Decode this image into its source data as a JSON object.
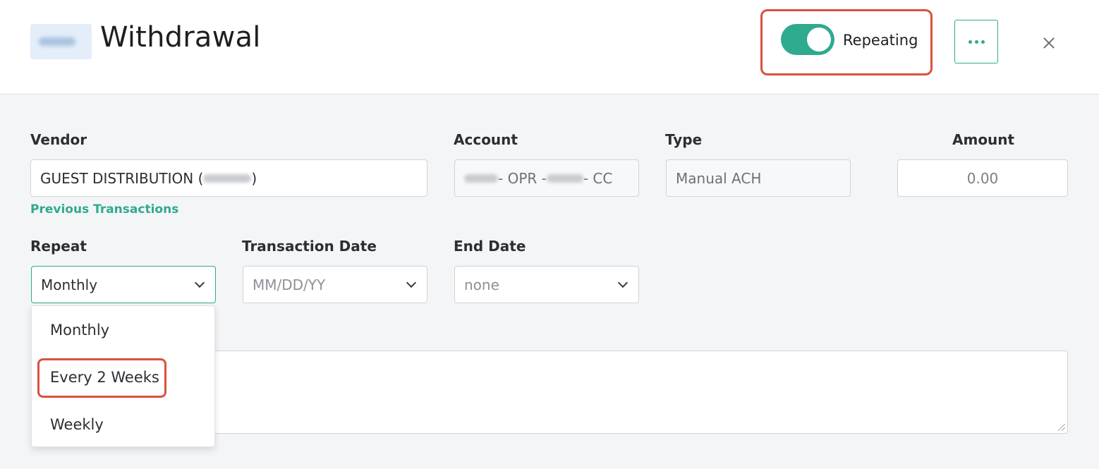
{
  "header": {
    "title": "Withdrawal",
    "logo": "FFBC",
    "repeating_label": "Repeating",
    "repeating_on": true,
    "more_icon": "ellipsis-icon",
    "close_icon": "close-icon"
  },
  "form": {
    "vendor_label": "Vendor",
    "vendor_prefix": "GUEST DISTRIBUTION (",
    "vendor_suffix": ")",
    "previous_transactions": "Previous Transactions",
    "account_label": "Account",
    "account_mid": " - OPR - ",
    "account_suffix": " - CC",
    "type_label": "Type",
    "type_value": "Manual ACH",
    "amount_label": "Amount",
    "amount_value": "0.00",
    "repeat_label": "Repeat",
    "repeat_value": "Monthly",
    "transaction_date_label": "Transaction Date",
    "transaction_date_placeholder": "MM/DD/YY",
    "end_date_label": "End Date",
    "end_date_value": "none"
  },
  "repeat_options": [
    "Monthly",
    "Every 2 Weeks",
    "Weekly"
  ],
  "colors": {
    "accent": "#2eaa8f",
    "highlight": "#d9533c"
  }
}
